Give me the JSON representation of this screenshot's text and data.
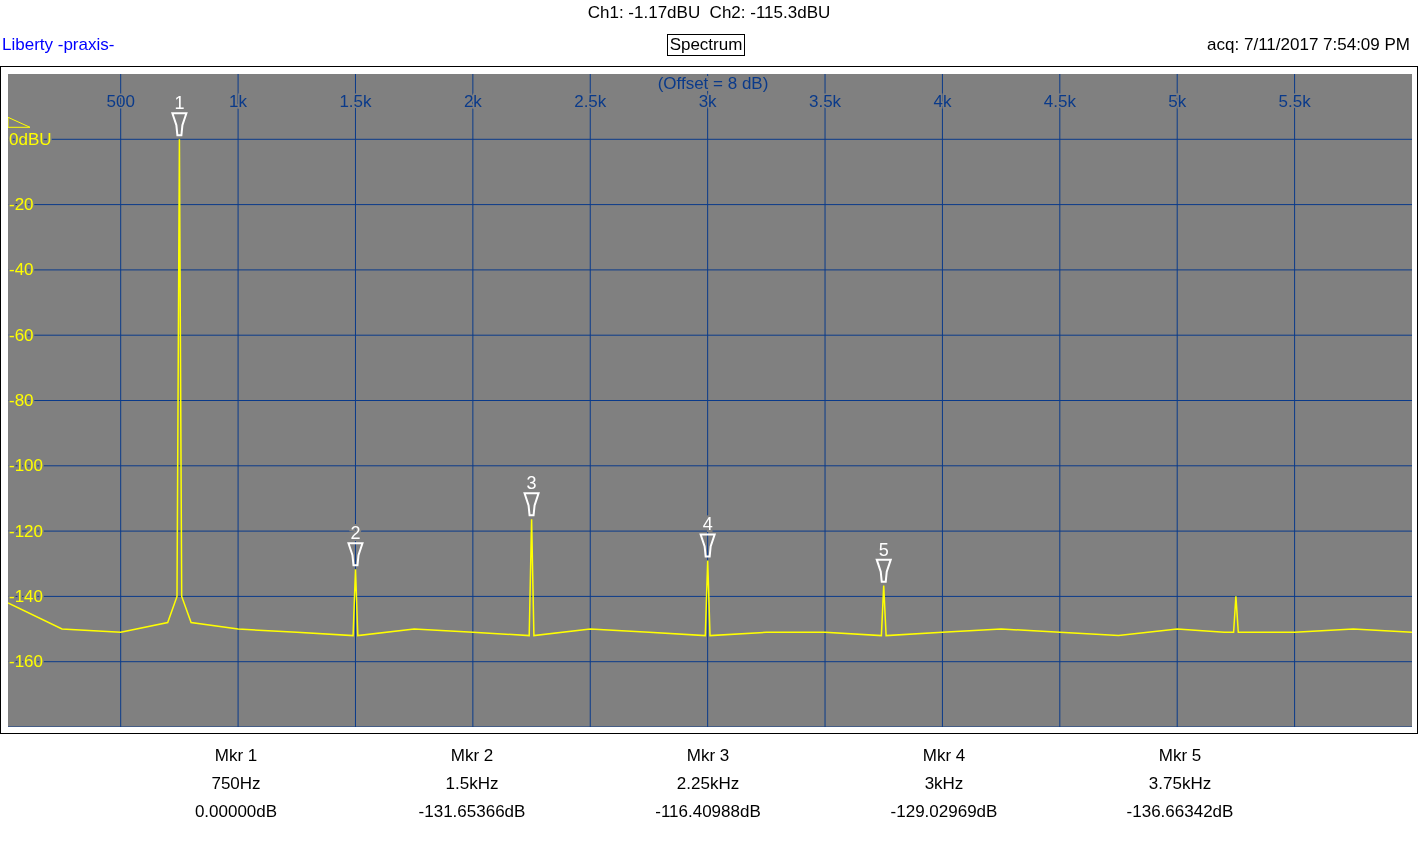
{
  "header": {
    "channels": "Ch1: -1.17dBU  Ch2: -115.3dBU",
    "brand": "Liberty -praxis-",
    "title": "Spectrum",
    "acquired": "acq: 7/11/2017 7:54:09 PM"
  },
  "plot": {
    "offset_note": "(Offset = 8 dB)",
    "markers": [
      "1",
      "2",
      "3",
      "4",
      "5"
    ],
    "chart_data": {
      "type": "line",
      "grid": true,
      "xlim": [
        20,
        6000
      ],
      "ylim": [
        -180,
        20
      ],
      "xticks": [
        {
          "value": 500,
          "label": "500"
        },
        {
          "value": 1000,
          "label": "1k"
        },
        {
          "value": 1500,
          "label": "1.5k"
        },
        {
          "value": 2000,
          "label": "2k"
        },
        {
          "value": 2500,
          "label": "2.5k"
        },
        {
          "value": 3000,
          "label": "3k"
        },
        {
          "value": 3500,
          "label": "3.5k"
        },
        {
          "value": 4000,
          "label": "4k"
        },
        {
          "value": 4500,
          "label": "4.5k"
        },
        {
          "value": 5000,
          "label": "5k"
        },
        {
          "value": 5500,
          "label": "5.5k"
        }
      ],
      "yticks": [
        {
          "value": 0,
          "label": "0dBU"
        },
        {
          "value": -20,
          "label": "-20"
        },
        {
          "value": -40,
          "label": "-40"
        },
        {
          "value": -60,
          "label": "-60"
        },
        {
          "value": -80,
          "label": "-80"
        },
        {
          "value": -100,
          "label": "-100"
        },
        {
          "value": -120,
          "label": "-120"
        },
        {
          "value": -140,
          "label": "-140"
        },
        {
          "value": -160,
          "label": "-160"
        }
      ],
      "x": [
        20,
        250,
        500,
        700,
        740,
        750,
        760,
        800,
        1000,
        1250,
        1490,
        1500,
        1510,
        1750,
        2000,
        2240,
        2250,
        2260,
        2500,
        2750,
        2990,
        3000,
        3010,
        3250,
        3500,
        3740,
        3750,
        3760,
        4000,
        4250,
        4500,
        4750,
        5000,
        5200,
        5240,
        5250,
        5260,
        5500,
        5750,
        6000
      ],
      "series": [
        {
          "color": "#ffff00",
          "values": [
            -142,
            -150,
            -151,
            -148,
            -140,
            0,
            -140,
            -148,
            -150,
            -151,
            -152,
            -131.7,
            -152,
            -150,
            -151,
            -152,
            -116.4,
            -152,
            -150,
            -151,
            -152,
            -129,
            -152,
            -151,
            -151,
            -152,
            -136.7,
            -152,
            -151,
            -150,
            -151,
            -152,
            -150,
            -151,
            -151,
            -140,
            -151,
            -151,
            -150,
            -151
          ]
        }
      ]
    }
  },
  "marker_readouts": [
    {
      "name": "Mkr 1",
      "frequency": "750Hz",
      "value": "0.00000dB"
    },
    {
      "name": "Mkr 2",
      "frequency": "1.5kHz",
      "value": "-131.65366dB"
    },
    {
      "name": "Mkr 3",
      "frequency": "2.25kHz",
      "value": "-116.40988dB"
    },
    {
      "name": "Mkr 4",
      "frequency": "3kHz",
      "value": "-129.02969dB"
    },
    {
      "name": "Mkr 5",
      "frequency": "3.75kHz",
      "value": "-136.66342dB"
    }
  ]
}
